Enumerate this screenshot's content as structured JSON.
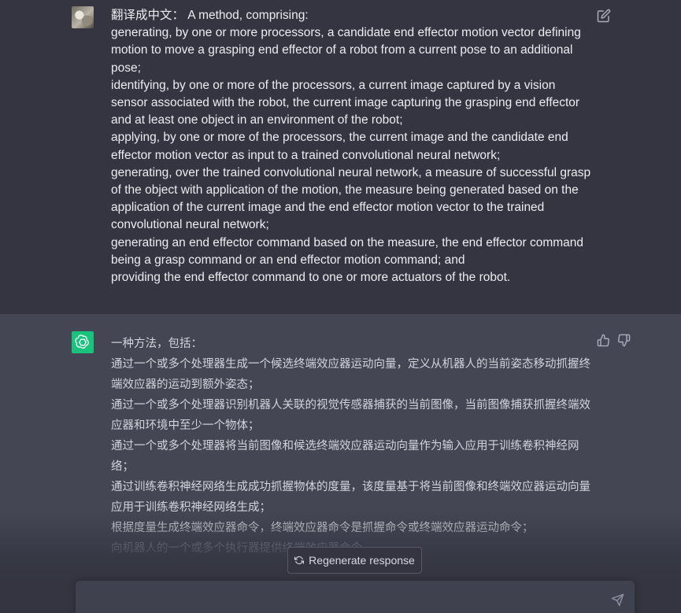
{
  "user_message": {
    "lines": [
      "翻译成中文： A method, comprising:",
      "generating, by one or more processors, a candidate end effector motion vector defining motion to move a grasping end effector of a robot from a current pose to an additional pose;",
      "identifying, by one or more of the processors, a current image captured by a vision sensor associated with the robot, the current image capturing the grasping end effector and at least one object in an environment of the robot;",
      "applying, by one or more of the processors, the current image and the candidate end effector motion vector as input to a trained convolutional neural network;",
      "generating, over the trained convolutional neural network, a measure of successful grasp of the object with application of the motion, the measure being generated based on the application of the current image and the end effector motion vector to the trained convolutional neural network;",
      "generating an end effector command based on the measure, the end effector command being a grasp command or an end effector motion command; and",
      "providing the end effector command to one or more actuators of the robot."
    ]
  },
  "assistant_message": {
    "lines": [
      "一种方法，包括：",
      "通过一个或多个处理器生成一个候选终端效应器运动向量，定义从机器人的当前姿态移动抓握终端效应器的运动到额外姿态；",
      "通过一个或多个处理器识别机器人关联的视觉传感器捕获的当前图像，当前图像捕获抓握终端效应器和环境中至少一个物体；",
      "通过一个或多个处理器将当前图像和候选终端效应器运动向量作为输入应用于训练卷积神经网络；",
      "通过训练卷积神经网络生成成功抓握物体的度量，该度量基于将当前图像和终端效应器运动向量应用于训练卷积神经网络生成；",
      "根据度量生成终端效应器命令，终端效应器命令是抓握命令或终端效应器运动命令；",
      "向机器人的一个或多个执行器提供终端效应器命令。"
    ]
  },
  "regenerate": {
    "label": "Regenerate response"
  },
  "icons": {
    "edit": "edit-icon",
    "thumbs_up": "thumbs-up-icon",
    "thumbs_down": "thumbs-down-icon",
    "regenerate": "refresh-icon",
    "send": "send-icon",
    "assistant_logo": "openai-logo-icon"
  },
  "colors": {
    "background": "#343541",
    "assistant_background": "#444654",
    "assistant_avatar": "#19c37d",
    "text": "#ececf1"
  }
}
